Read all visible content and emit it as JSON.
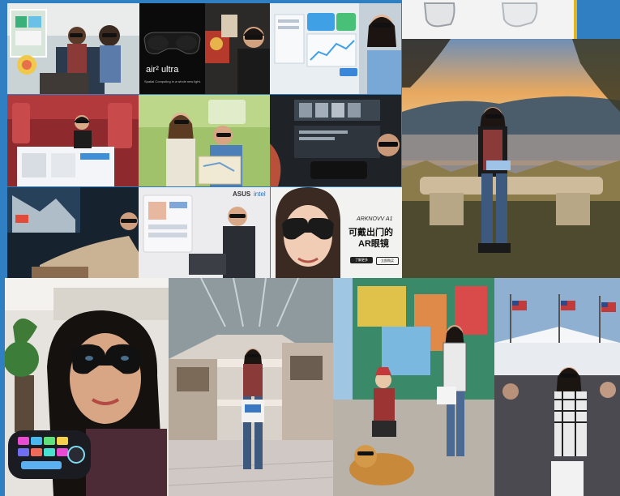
{
  "collage": {
    "tile_air_ultra": {
      "logo_text": "air² ultra",
      "tagline": "Spatial Computing in a whole new light."
    },
    "tile_asus_ad": {
      "brand": "ASUS",
      "partner": "intel"
    },
    "tile_arknovv_ad": {
      "brand": "ARKNOVV A1",
      "headline_line1": "可戴出门的",
      "headline_line2": "AR眼镜",
      "button_primary": "了解更多",
      "button_secondary": "立即购买"
    }
  },
  "colors": {
    "frame_blue": "#2f7fc2",
    "lens_dark": "#141414",
    "sunset_sky": "#e7a85f",
    "water": "#8f8a8a",
    "mall_floor": "#cfc8c4",
    "tent_white": "#e8ecf0",
    "flag_red": "#c23a3a"
  }
}
